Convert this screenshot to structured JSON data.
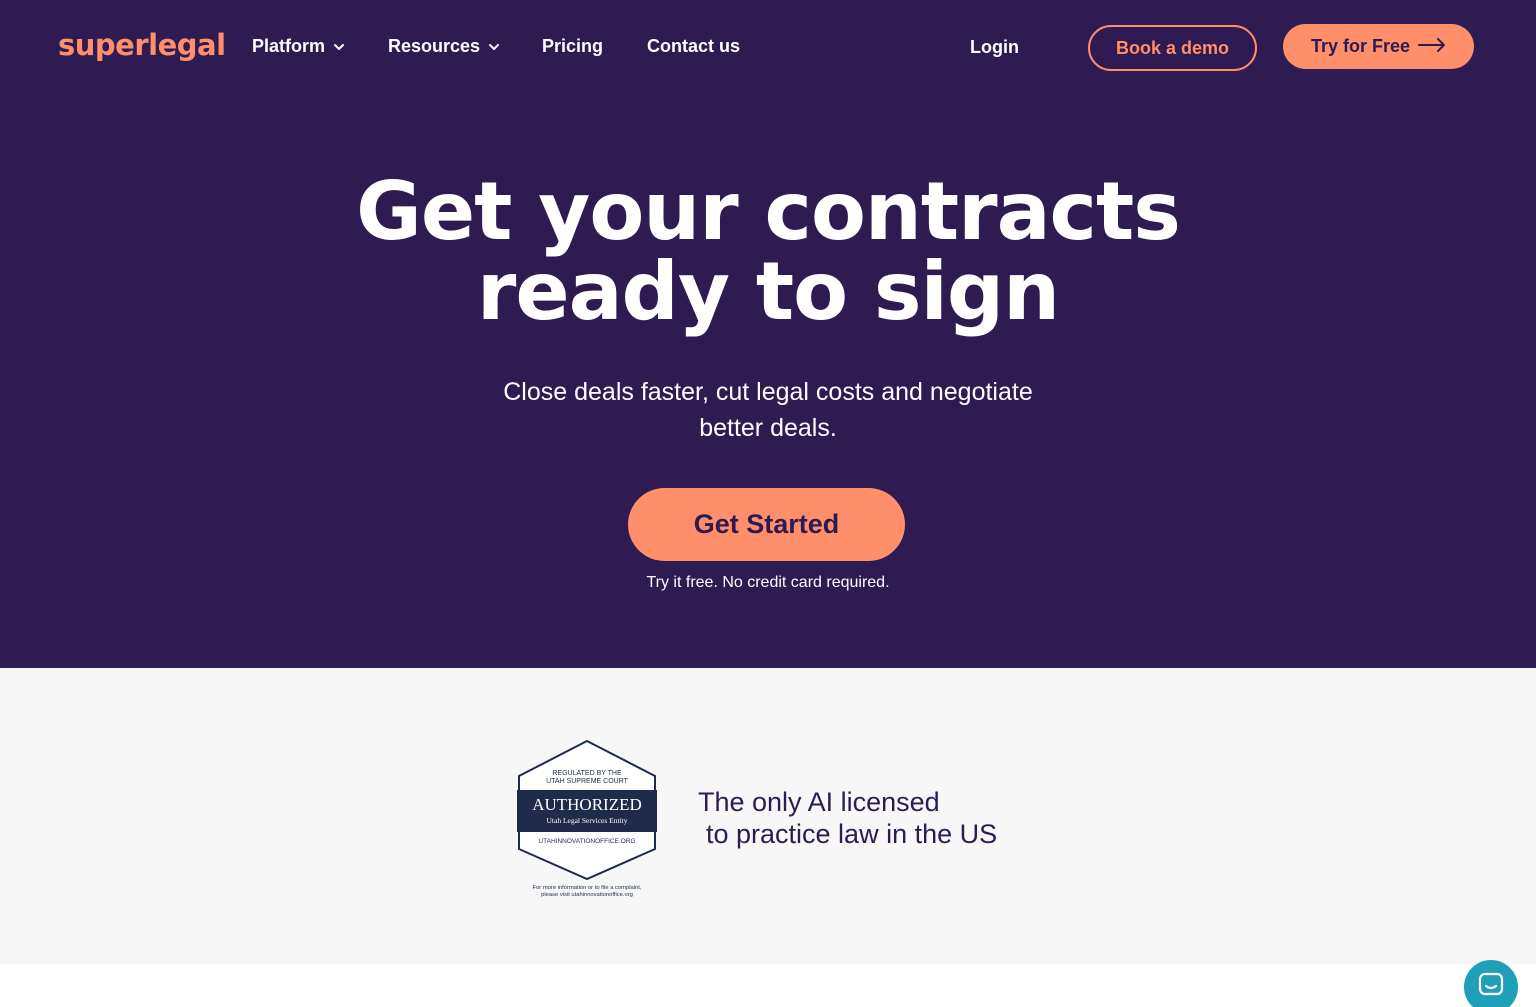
{
  "brand": {
    "logo": "superlegal"
  },
  "nav": {
    "platform": "Platform",
    "resources": "Resources",
    "pricing": "Pricing",
    "contact": "Contact us",
    "login": "Login",
    "book_demo": "Book a demo",
    "try_free": "Try for Free"
  },
  "hero": {
    "title_line1": "Get your contracts",
    "title_line2": "ready to sign",
    "subtitle": "Close deals faster, cut legal costs and negotiate better deals.",
    "cta": "Get Started",
    "note": "Try it free. No credit card required."
  },
  "badge": {
    "regulated_line1": "REGULATED BY THE",
    "regulated_line2": "UTAH SUPREME COURT",
    "authorized": "AUTHORIZED",
    "entity": "Utah Legal Services Entity",
    "site": "UTAHINNOVATIONOFFICE.ORG",
    "footer_line1": "For more information or to file a complaint,",
    "footer_line2": "please visit utahinnovationoffice.org"
  },
  "licensed": {
    "line1": "The only AI licensed",
    "line2": "to practice law in the US"
  },
  "colors": {
    "hero_bg": "#2d1b52",
    "accent": "#ff8e6a",
    "band_bg": "#f7f7f8",
    "chat": "#1f9fb8"
  },
  "icons": {
    "chevron": "chevron-down-icon",
    "arrow": "arrow-right-icon",
    "chat": "chat-icon"
  }
}
